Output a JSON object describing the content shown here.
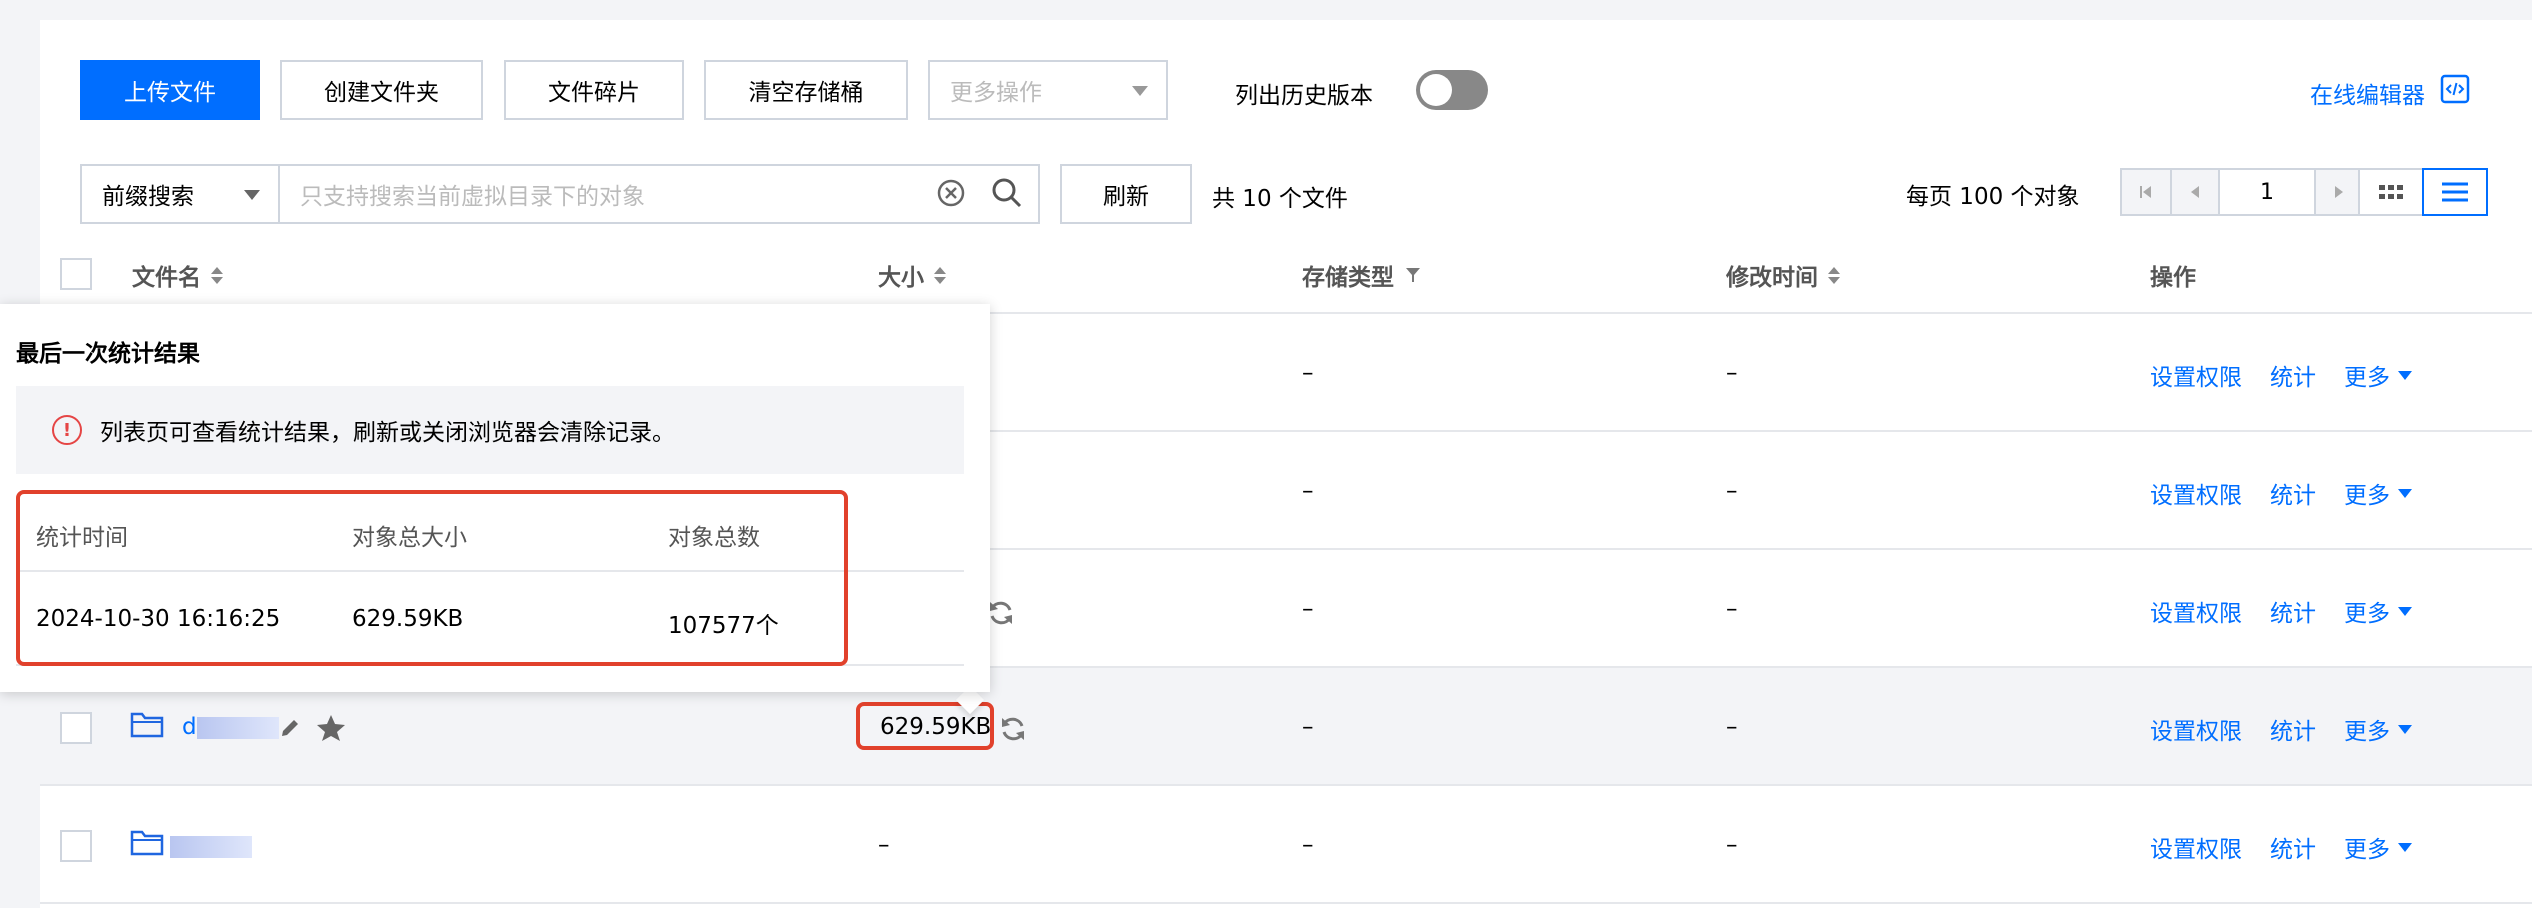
{
  "toolbar": {
    "upload": "上传文件",
    "create_folder": "创建文件夹",
    "fragments": "文件碎片",
    "clear_bucket": "清空存储桶",
    "more_actions": "更多操作",
    "history_label": "列出历史版本",
    "online_editor": "在线编辑器"
  },
  "search": {
    "mode": "前缀搜索",
    "placeholder": "只支持搜索当前虚拟目录下的对象",
    "refresh": "刷新",
    "total": "共 10 个文件",
    "per_page": "每页 100 个对象",
    "page": "1"
  },
  "table": {
    "columns": {
      "name": "文件名",
      "size": "大小",
      "storage": "存储类型",
      "modified": "修改时间",
      "actions": "操作"
    },
    "rows": [
      {
        "name": "",
        "size": "",
        "storage": "–",
        "modified": "–"
      },
      {
        "name": "",
        "size": "",
        "storage": "–",
        "modified": "–"
      },
      {
        "name": "",
        "size": "",
        "storage": "–",
        "modified": "–"
      },
      {
        "name": "d",
        "size": "629.59KB",
        "storage": "–",
        "modified": "–"
      },
      {
        "name": "",
        "size": "–",
        "storage": "–",
        "modified": "–"
      }
    ],
    "action_labels": {
      "permission": "设置权限",
      "stats": "统计",
      "more": "更多"
    }
  },
  "popover": {
    "title": "最后一次统计结果",
    "notice": "列表页可查看统计结果，刷新或关闭浏览器会清除记录。",
    "headers": [
      "统计时间",
      "对象总大小",
      "对象总数"
    ],
    "values": [
      "2024-10-30 16:16:25",
      "629.59KB",
      "107577个"
    ]
  },
  "colors": {
    "primary": "#006eff",
    "highlight_border": "#e1412c",
    "warning": "#e54545"
  }
}
